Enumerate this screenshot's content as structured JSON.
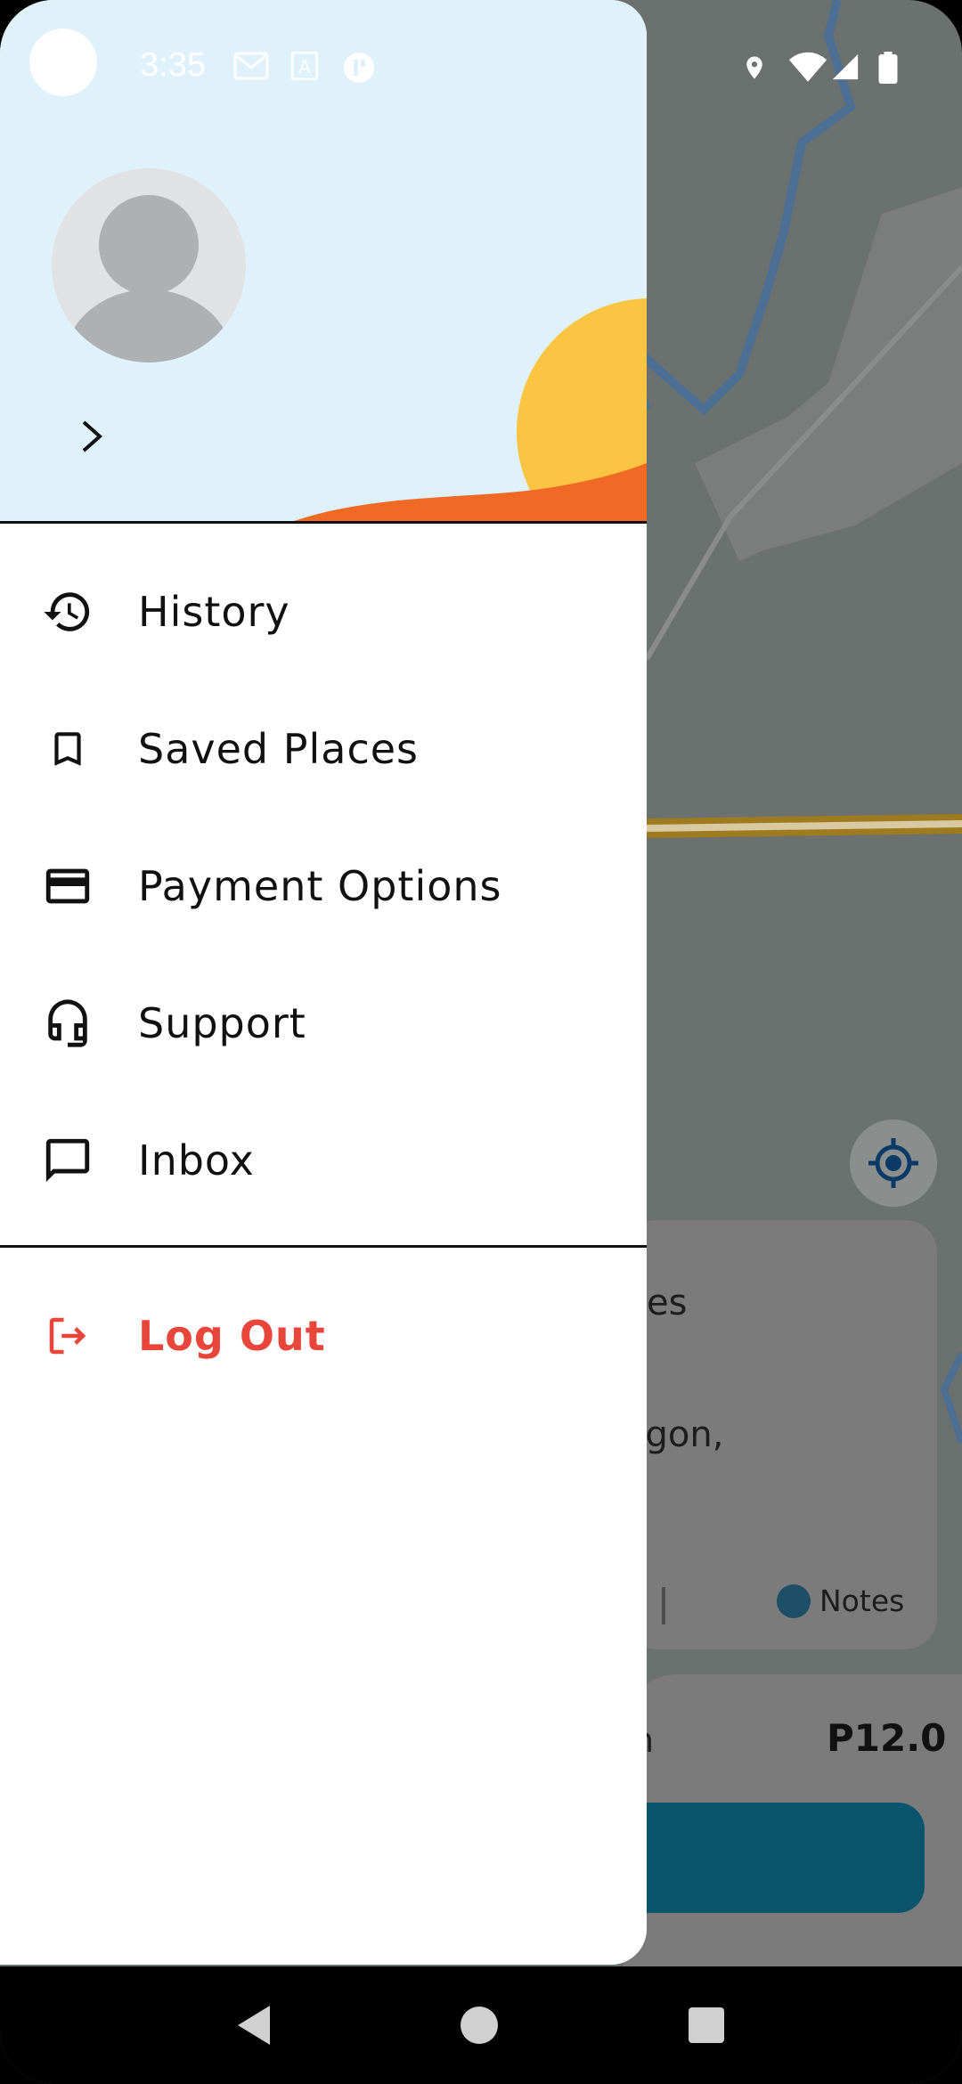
{
  "status_bar": {
    "time": "3:35",
    "left_icons": [
      "gmail-icon",
      "a-icon",
      "app-icon"
    ],
    "right_icons": [
      "location-icon",
      "wifi-icon",
      "signal-icon",
      "battery-icon"
    ]
  },
  "drawer": {
    "menu": [
      {
        "label": "History",
        "icon": "history-icon"
      },
      {
        "label": "Saved Places",
        "icon": "bookmark-icon"
      },
      {
        "label": "Payment Options",
        "icon": "credit-card-icon"
      },
      {
        "label": "Support",
        "icon": "headset-icon"
      },
      {
        "label": "Inbox",
        "icon": "chat-icon"
      }
    ],
    "logout": {
      "label": "Log Out",
      "icon": "logout-icon",
      "color": "#e8463a"
    }
  },
  "background": {
    "trip_text_1": "es",
    "trip_text_2": "ogon,",
    "notes_label": "Notes",
    "fare_label": "n",
    "fare_value": "P12.0"
  },
  "colors": {
    "header_bg": "#dff2fb",
    "sun": "#fcc443",
    "wave": "#f06a25",
    "logout": "#e8463a",
    "primary_button": "#0b546e"
  }
}
